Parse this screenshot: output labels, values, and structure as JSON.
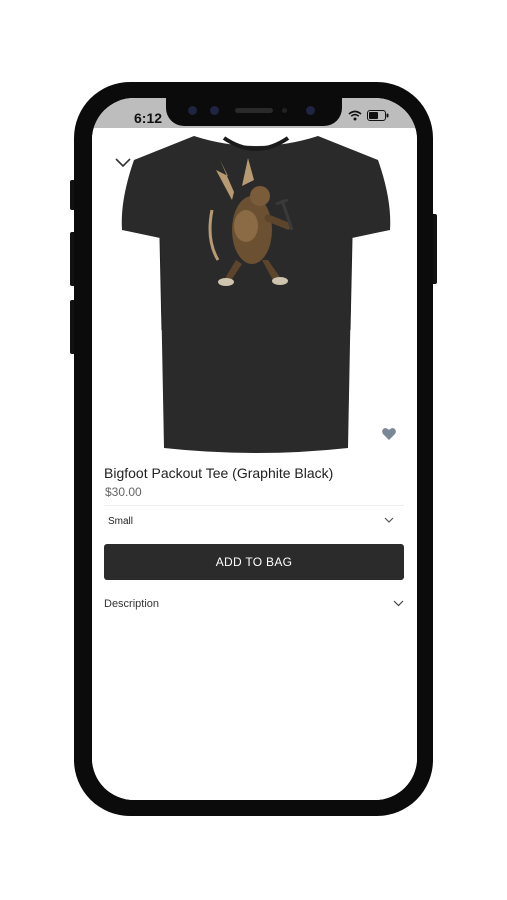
{
  "status_bar": {
    "time": "6:12",
    "icons": [
      "wifi-icon",
      "battery-icon"
    ]
  },
  "product": {
    "title": "Bigfoot Packout Tee (Graphite Black)",
    "price": "$30.00",
    "image": "black-tshirt-bigfoot-graphic"
  },
  "size_select": {
    "selected": "Small"
  },
  "actions": {
    "add_to_bag": "ADD TO BAG"
  },
  "accordion": {
    "description_label": "Description"
  },
  "colors": {
    "button_bg": "#2b2b2b",
    "heart": "#7a8797",
    "status_bar_bg": "#bdbdbd"
  }
}
